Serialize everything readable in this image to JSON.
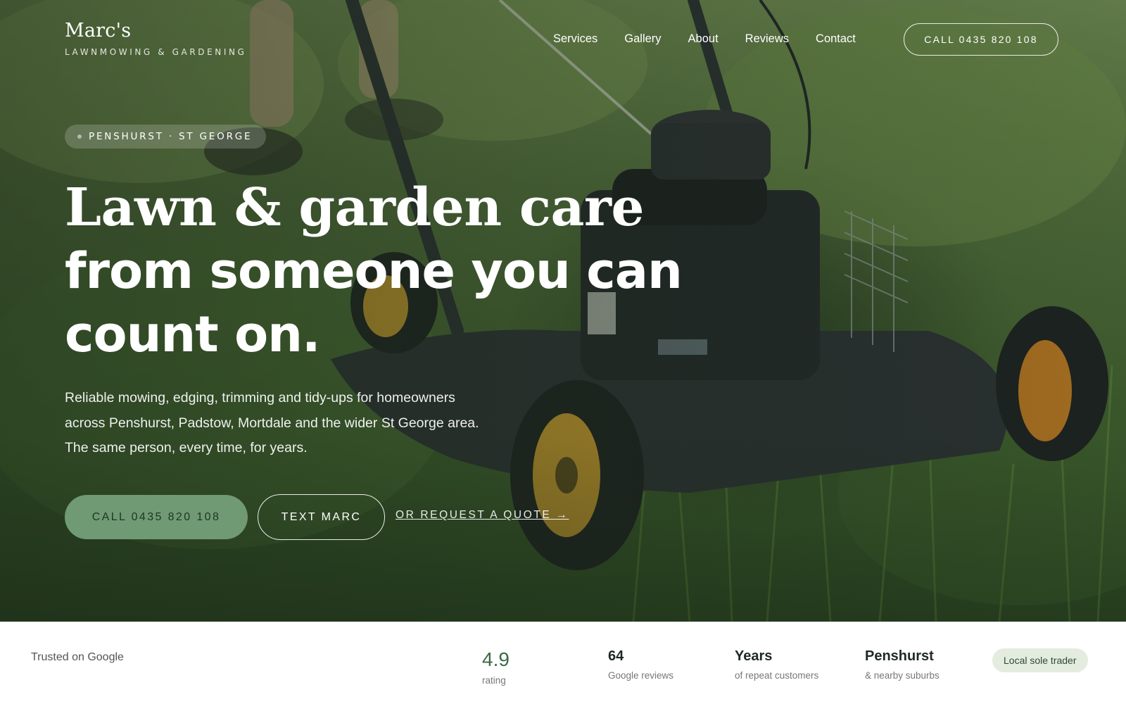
{
  "brand": {
    "name": "Marc's",
    "tagline": "LAWNMOWING & GARDENING"
  },
  "nav": {
    "links": [
      "Services",
      "Gallery",
      "About",
      "Reviews",
      "Contact"
    ],
    "call_button": "CALL 0435 820 108"
  },
  "hero": {
    "image": "lawn-mower-on-grass-photo",
    "badge": "PENSHURST · ST GEORGE",
    "headline_line1": "Lawn & garden care",
    "headline_line2": "from someone you can",
    "headline_line3": "count on.",
    "lede_line1": "Reliable mowing, edging, trimming and tidy-ups for homeowners",
    "lede_line2": "across Penshurst, Padstow, Mortdale and the wider St George area.",
    "lede_line3": "The same person, every time, for years.",
    "cta_call": "CALL 0435 820 108",
    "cta_text": "TEXT MARC",
    "cta_quote": "OR REQUEST A QUOTE →"
  },
  "trust_bar": {
    "label": "Trusted on Google",
    "stats": [
      {
        "value": "4.9",
        "caption": "rating"
      },
      {
        "value": "64",
        "caption": "Google reviews"
      },
      {
        "value": "Years",
        "caption": "of repeat customers"
      },
      {
        "value": "Penshurst",
        "caption": "& nearby suburbs"
      }
    ],
    "pill": "Local sole trader"
  },
  "colors": {
    "accent_green": "#6f9a73",
    "dark_green": "#2f4a34",
    "pill_bg": "#e3ecde"
  }
}
